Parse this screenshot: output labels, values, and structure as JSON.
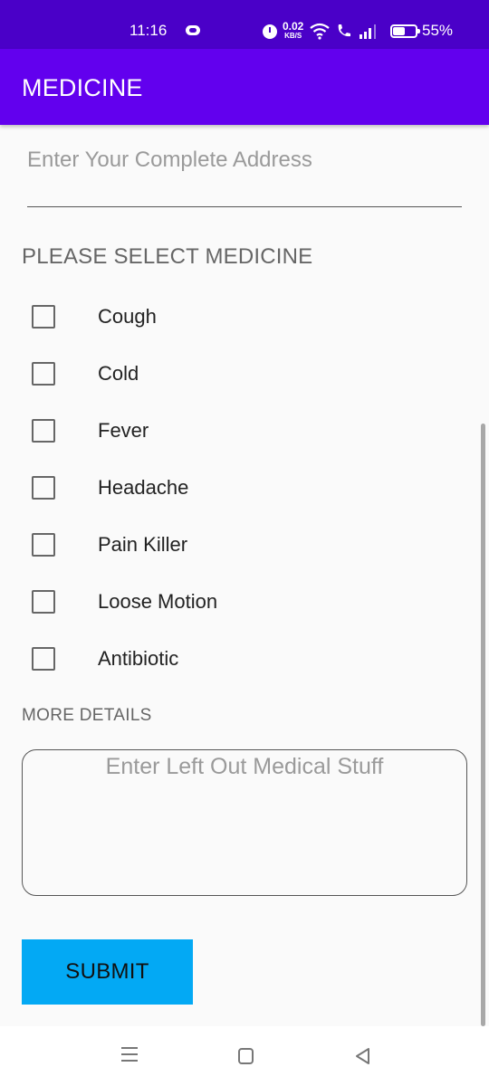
{
  "status_bar": {
    "time": "11:16",
    "network_speed": "0.02",
    "network_speed_unit": "KB/S",
    "battery": "55%"
  },
  "app_bar": {
    "title": "MEDICINE"
  },
  "form": {
    "address_placeholder": "Enter Your Complete Address",
    "medicine_section_label": "PLEASE SELECT MEDICINE",
    "medicines": [
      {
        "label": "Cough",
        "checked": false
      },
      {
        "label": "Cold",
        "checked": false
      },
      {
        "label": "Fever",
        "checked": false
      },
      {
        "label": "Headache",
        "checked": false
      },
      {
        "label": "Pain Killer",
        "checked": false
      },
      {
        "label": "Loose Motion",
        "checked": false
      },
      {
        "label": "Antibiotic",
        "checked": false
      }
    ],
    "more_details_label": "MORE DETAILS",
    "more_details_placeholder": "Enter Left Out Medical Stuff",
    "submit_label": "SUBMIT"
  },
  "colors": {
    "status_bar": "#4a00c8",
    "app_bar": "#6200ee",
    "submit_button": "#03a9f4"
  },
  "icons": {
    "status": [
      "alarm-icon",
      "wifi-icon",
      "call-icon",
      "signal-icon",
      "battery-icon"
    ],
    "nav": [
      "menu-icon",
      "home-icon",
      "back-icon"
    ]
  }
}
